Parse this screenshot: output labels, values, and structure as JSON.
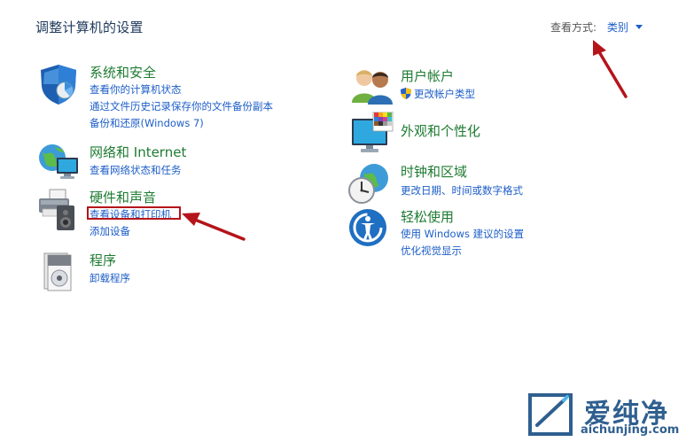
{
  "header": {
    "title": "调整计算机的设置",
    "view_by_label": "查看方式:",
    "view_by_value": "类别"
  },
  "categories_left": [
    {
      "title": "系统和安全",
      "icon": "shield-icon",
      "links": [
        "查看你的计算机状态",
        "通过文件历史记录保存你的文件备份副本",
        "备份和还原(Windows 7)"
      ]
    },
    {
      "title": "网络和 Internet",
      "icon": "network-globe-icon",
      "links": [
        "查看网络状态和任务"
      ]
    },
    {
      "title": "硬件和声音",
      "icon": "printer-speaker-icon",
      "links": [
        "查看设备和打印机",
        "添加设备"
      ]
    },
    {
      "title": "程序",
      "icon": "programs-icon",
      "links": [
        "卸载程序"
      ]
    }
  ],
  "categories_right": [
    {
      "title": "用户帐户",
      "icon": "users-icon",
      "links": [
        "更改帐户类型"
      ]
    },
    {
      "title": "外观和个性化",
      "icon": "monitor-palette-icon",
      "links": []
    },
    {
      "title": "时钟和区域",
      "icon": "clock-globe-icon",
      "links": [
        "更改日期、时间或数字格式"
      ]
    },
    {
      "title": "轻松使用",
      "icon": "ease-of-access-icon",
      "links": [
        "使用 Windows 建议的设置",
        "优化视觉显示"
      ]
    }
  ],
  "watermark": {
    "brand": "爱纯净",
    "url": "aichunjing.com"
  },
  "colors": {
    "category_title": "#1e7b31",
    "link": "#1d5ec8",
    "annotation_red": "#b5141a"
  }
}
